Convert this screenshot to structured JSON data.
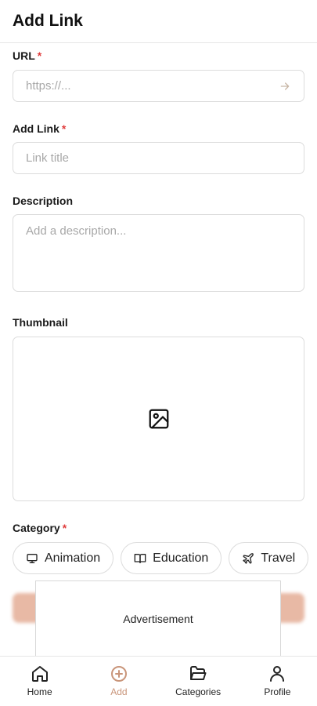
{
  "header": {
    "title": "Add Link"
  },
  "form": {
    "url": {
      "label": "URL",
      "required": "*",
      "placeholder": "https://..."
    },
    "title": {
      "label": "Add Link",
      "required": "*",
      "placeholder": "Link title"
    },
    "description": {
      "label": "Description",
      "placeholder": "Add a description..."
    },
    "thumbnail": {
      "label": "Thumbnail",
      "icon": "image-icon"
    },
    "category": {
      "label": "Category",
      "required": "*",
      "options": [
        {
          "label": "Animation",
          "icon": "monitor-icon"
        },
        {
          "label": "Education",
          "icon": "book-icon"
        },
        {
          "label": "Travel",
          "icon": "plane-icon"
        }
      ]
    }
  },
  "ad": {
    "label": "Advertisement"
  },
  "nav": {
    "items": [
      {
        "label": "Home",
        "icon": "home-icon"
      },
      {
        "label": "Add",
        "icon": "plus-circle-icon",
        "active": true
      },
      {
        "label": "Categories",
        "icon": "folder-icon"
      },
      {
        "label": "Profile",
        "icon": "user-icon"
      }
    ]
  },
  "colors": {
    "accent": "#c9957a",
    "required": "#e03d3d",
    "submit": "#e8b9a5"
  }
}
